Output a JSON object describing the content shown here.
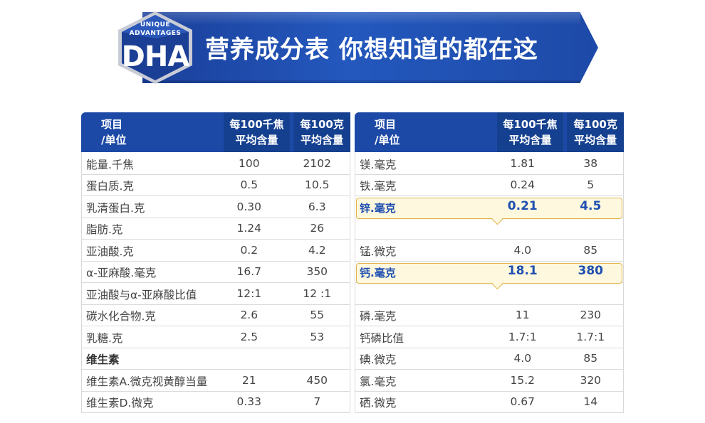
{
  "banner": {
    "badge_line1": "UNIQUE",
    "badge_line2": "ADVANTAGES",
    "badge_main": "DHA",
    "title": "营养成分表  你想知道的都在这"
  },
  "colors": {
    "header_blue": "#1d49a6",
    "highlight_border": "#e3b34a",
    "highlight_fill": "#fdf8de",
    "highlight_text": "#1e4fb0"
  },
  "left_table": {
    "headers": [
      "项目\n/单位",
      "每100千焦\n平均含量",
      "每100克\n平均含量"
    ],
    "rows": [
      {
        "item": "能量.千焦",
        "per_kj": "100",
        "per_g": "2102"
      },
      {
        "item": "蛋白质.克",
        "per_kj": "0.5",
        "per_g": "10.5"
      },
      {
        "item": "乳清蛋白.克",
        "per_kj": "0.30",
        "per_g": "6.3"
      },
      {
        "item": "脂肪.克",
        "per_kj": "1.24",
        "per_g": "26"
      },
      {
        "item": "亚油酸.克",
        "per_kj": "0.2",
        "per_g": "4.2"
      },
      {
        "item": "α-亚麻酸.毫克",
        "per_kj": "16.7",
        "per_g": "350"
      },
      {
        "item": "亚油酸与α-亚麻酸比值",
        "per_kj": "12:1",
        "per_g": "12 :1"
      },
      {
        "item": "碳水化合物.克",
        "per_kj": "2.6",
        "per_g": "55"
      },
      {
        "item": "乳糖.克",
        "per_kj": "2.5",
        "per_g": "53"
      },
      {
        "item": "维生素",
        "per_kj": "",
        "per_g": ""
      },
      {
        "item": "维生素A.微克视黄醇当量",
        "per_kj": "21",
        "per_g": "450"
      },
      {
        "item": "维生素D.微克",
        "per_kj": "0.33",
        "per_g": "7"
      }
    ]
  },
  "right_table": {
    "headers": [
      "项目\n/单位",
      "每100千焦\n平均含量",
      "每100克\n平均含量"
    ],
    "rows": [
      {
        "item": "镁.毫克",
        "per_kj": "1.81",
        "per_g": "38"
      },
      {
        "item": "铁.毫克",
        "per_kj": "0.24",
        "per_g": "5"
      },
      {
        "item": "锌.毫克",
        "per_kj": "0.21",
        "per_g": "4.5"
      },
      {
        "item": "",
        "per_kj": "",
        "per_g": ""
      },
      {
        "item": "锰.微克",
        "per_kj": "4.0",
        "per_g": "85"
      },
      {
        "item": "钙.毫克",
        "per_kj": "18.1",
        "per_g": "380"
      },
      {
        "item": "",
        "per_kj": "",
        "per_g": ""
      },
      {
        "item": "磷.毫克",
        "per_kj": "11",
        "per_g": "230"
      },
      {
        "item": "钙磷比值",
        "per_kj": "1.7:1",
        "per_g": "1.7:1"
      },
      {
        "item": "碘.微克",
        "per_kj": "4.0",
        "per_g": "85"
      },
      {
        "item": "氯.毫克",
        "per_kj": "15.2",
        "per_g": "320"
      },
      {
        "item": "硒.微克",
        "per_kj": "0.67",
        "per_g": "14"
      }
    ]
  }
}
